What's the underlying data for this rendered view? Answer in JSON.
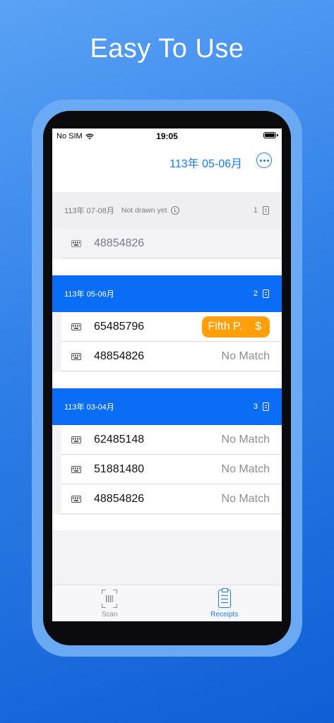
{
  "promo": {
    "headline": "Easy To Use"
  },
  "statusbar": {
    "carrier": "No SIM",
    "time": "19:05"
  },
  "navbar": {
    "title": "113年 05-06月",
    "more_icon": "ellipsis-circle-icon"
  },
  "sections": [
    {
      "period": "113年 07-08月",
      "note": "Not drawn yet",
      "count": "1",
      "receipts": [
        {
          "number": "48854826",
          "status": ""
        }
      ]
    },
    {
      "period": "113年 05-06月",
      "note": "",
      "count": "2",
      "receipts": [
        {
          "number": "65485796",
          "prize": "Fifth P.",
          "prize_symbol": "$"
        },
        {
          "number": "48854826",
          "status": "No Match"
        }
      ]
    },
    {
      "period": "113年 03-04月",
      "note": "",
      "count": "3",
      "receipts": [
        {
          "number": "62485148",
          "status": "No Match"
        },
        {
          "number": "51881480",
          "status": "No Match"
        },
        {
          "number": "48854826",
          "status": "No Match"
        }
      ]
    }
  ],
  "tabbar": {
    "tabs": [
      {
        "label": "Scan",
        "icon": "barcode-scan-icon",
        "active": false
      },
      {
        "label": "Receipts",
        "icon": "clipboard-list-icon",
        "active": true
      }
    ]
  },
  "colors": {
    "accent": "#1a7cf5",
    "section_active": "#0a6df5",
    "prize": "#ff9f0a"
  }
}
